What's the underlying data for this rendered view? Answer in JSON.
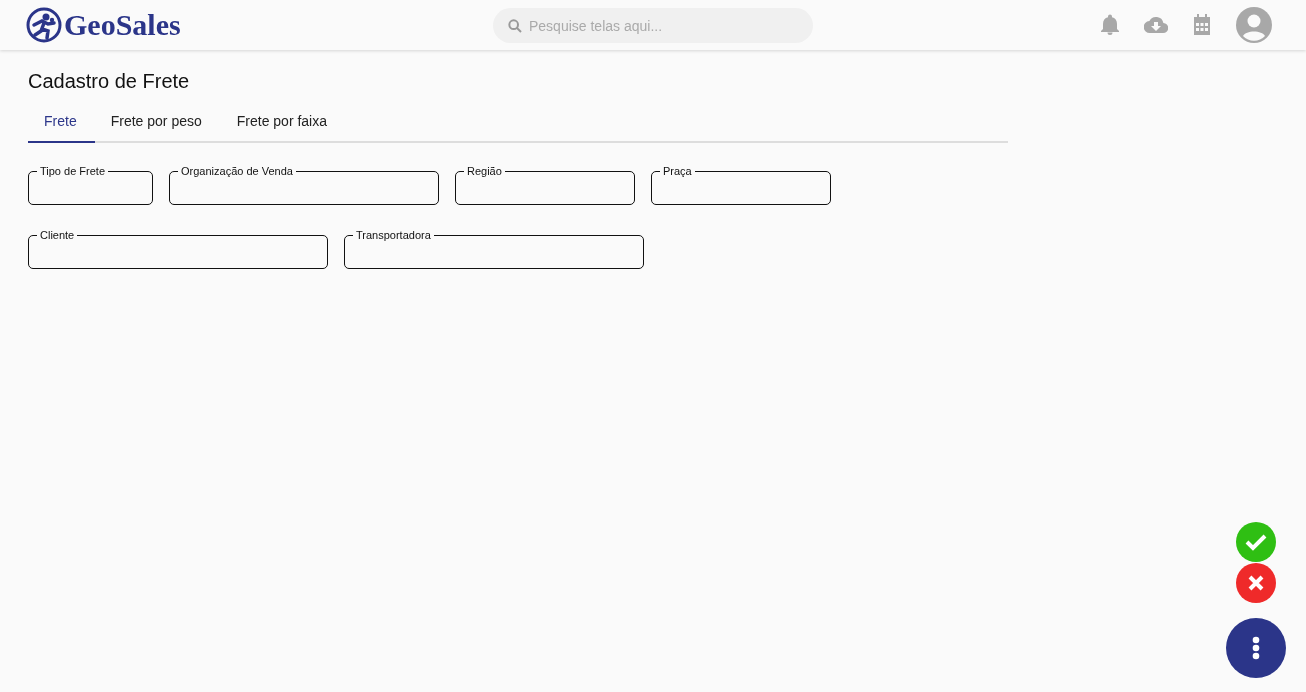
{
  "header": {
    "logo": "GeoSales",
    "search": {
      "placeholder": "Pesquise telas aqui..."
    }
  },
  "page_title": "Cadastro de Frete",
  "tabs": [
    {
      "label": "Frete",
      "selected": true
    },
    {
      "label": "Frete por peso",
      "selected": false
    },
    {
      "label": "Frete por faixa",
      "selected": false
    }
  ],
  "form_rows": [
    [
      {
        "label": "Tipo de Frete"
      },
      {
        "label": "Organização de Venda"
      },
      {
        "label": "Região"
      },
      {
        "label": "Praça"
      }
    ],
    [
      {
        "label": "Cliente"
      },
      {
        "label": "Transportadora"
      }
    ]
  ],
  "actions": [
    {
      "kind": "confirm"
    },
    {
      "kind": "cancel"
    },
    {
      "kind": "more"
    }
  ]
}
